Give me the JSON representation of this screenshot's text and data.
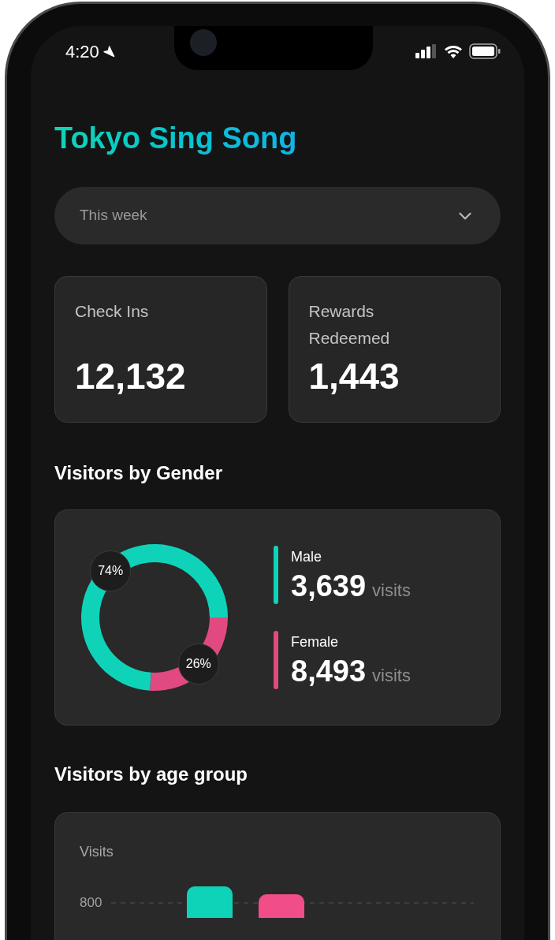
{
  "status_bar": {
    "time": "4:20"
  },
  "app": {
    "title": "Tokyo Sing Song"
  },
  "period_select": {
    "value": "This week"
  },
  "stats": [
    {
      "label": "Check Ins",
      "value": "12,132"
    },
    {
      "label": "Rewards Redeemed",
      "value": "1,443"
    }
  ],
  "gender_section": {
    "title": "Visitors by Gender",
    "chart_data": {
      "type": "donut",
      "series": [
        {
          "values": [
            74,
            26
          ]
        }
      ],
      "value_labels": [
        "74%",
        "26%"
      ]
    },
    "legend": [
      {
        "name": "Male",
        "color": "#0fd3b9",
        "count": "3,639",
        "unit": "visits"
      },
      {
        "name": "Female",
        "color": "#e04a80",
        "count": "8,493",
        "unit": "visits"
      }
    ]
  },
  "age_section": {
    "title": "Visitors by age group",
    "axis_label": "Visits",
    "ytick_label": "800",
    "bars": [
      {
        "color": "#0fd3b9"
      },
      {
        "color": "#f14d88"
      }
    ]
  }
}
